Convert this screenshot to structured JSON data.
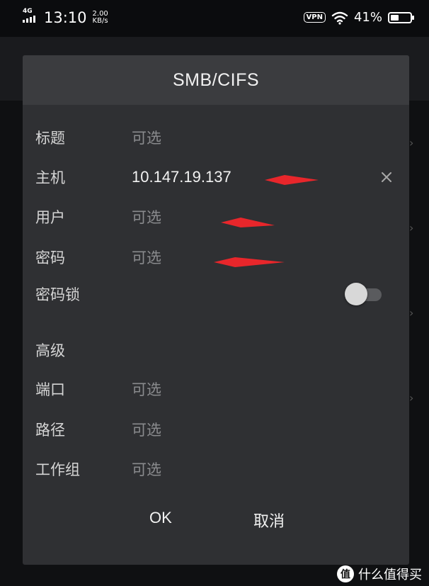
{
  "status_bar": {
    "network": "4G",
    "time": "13:10",
    "speed_value": "2.00",
    "speed_unit": "KB/s",
    "vpn": "VPN",
    "battery_percent": "41%",
    "battery_level": 0.41
  },
  "dialog": {
    "title": "SMB/CIFS",
    "fields": {
      "title": {
        "label": "标题",
        "placeholder": "可选"
      },
      "host": {
        "label": "主机",
        "value": "10.147.19.137"
      },
      "user": {
        "label": "用户",
        "placeholder": "可选"
      },
      "password": {
        "label": "密码",
        "placeholder": "可选"
      },
      "password_lock": {
        "label": "密码锁",
        "enabled": false
      }
    },
    "advanced": {
      "heading": "高级",
      "port": {
        "label": "端口",
        "placeholder": "可选"
      },
      "path": {
        "label": "路径",
        "placeholder": "可选"
      },
      "workgroup": {
        "label": "工作组",
        "placeholder": "可选"
      }
    },
    "buttons": {
      "ok": "OK",
      "cancel": "取消"
    }
  },
  "annotation_color": "#e8262b",
  "watermark": {
    "text": "什么值得买",
    "logo": "值"
  }
}
